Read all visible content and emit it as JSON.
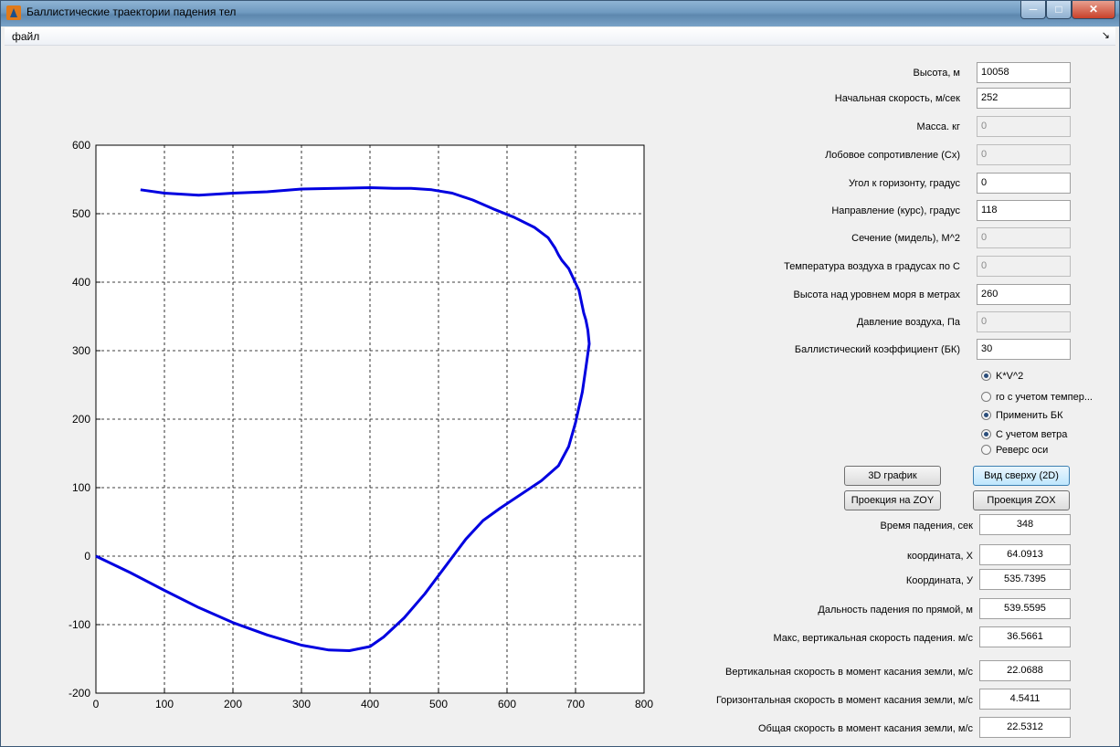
{
  "window": {
    "title": "Баллистические траектории падения тел",
    "icons": {
      "app": "matlab-icon",
      "min": "minimize-icon",
      "max": "maximize-icon",
      "close": "close-icon"
    }
  },
  "menu": {
    "file": "файл",
    "arrow": "↘"
  },
  "inputs": [
    {
      "label": "Высота, м",
      "value": "10058",
      "disabled": false
    },
    {
      "label": "Начальная скорость, м/сек",
      "value": "252",
      "disabled": false
    },
    {
      "label": "Масса. кг",
      "value": "0",
      "disabled": true
    },
    {
      "label": "Лобовое сопротивление (Cx)",
      "value": "0",
      "disabled": true
    },
    {
      "label": "Угол к горизонту, градус",
      "value": "0",
      "disabled": false
    },
    {
      "label": "Направление  (курс), градус",
      "value": "118",
      "disabled": false
    },
    {
      "label": "Сечение (мидель), M^2",
      "value": "0",
      "disabled": true
    },
    {
      "label": "Температура воздуха в градусах по С",
      "value": "0",
      "disabled": true
    },
    {
      "label": "Высота над уровнем моря в метрах",
      "value": "260",
      "disabled": false
    },
    {
      "label": "Давление воздуха, Па",
      "value": "0",
      "disabled": true
    },
    {
      "label": "Баллистический коэффициент (БК)",
      "value": "30",
      "disabled": false
    }
  ],
  "radios": [
    {
      "label": "K*V^2",
      "checked": true
    },
    {
      "label": "ro с учетом темпер...",
      "checked": false
    },
    {
      "label": "Применить БК",
      "checked": true
    },
    {
      "label": "С учетом ветра",
      "checked": true
    },
    {
      "label": "Реверс оси",
      "checked": false
    }
  ],
  "buttons": {
    "graph3d": "3D график",
    "topview": "Вид сверху (2D)",
    "zoy": "Проекция на ZOY",
    "zox": "Проекция ZOX"
  },
  "outputs": [
    {
      "label": "Время падения, сек",
      "value": "348"
    },
    {
      "label": "координата, X",
      "value": "64.0913"
    },
    {
      "label": "Координата, У",
      "value": "535.7395"
    },
    {
      "label": "Дальность падения по прямой, м",
      "value": "539.5595"
    },
    {
      "label": "Макс,  вертикальная скорость падения. м/с",
      "value": "36.5661"
    },
    {
      "label": "Вертикальная  скорость в момент касания земли, м/с",
      "value": "22.0688"
    },
    {
      "label": "Горизонтальная скорость в момент касания земли, м/с",
      "value": "4.5411"
    },
    {
      "label": "Общая скорость в момент касания земли, м/с",
      "value": "22.5312"
    }
  ],
  "chart_data": {
    "type": "line",
    "title": "",
    "xlabel": "",
    "ylabel": "",
    "xlim": [
      0,
      800
    ],
    "ylim": [
      -200,
      600
    ],
    "xticks": [
      "0",
      "100",
      "200",
      "300",
      "400",
      "500",
      "600",
      "700",
      "800"
    ],
    "yticks": [
      "600",
      "500",
      "400",
      "300",
      "200",
      "100",
      "0",
      "-100",
      "-200"
    ],
    "grid": true,
    "line_color": "#0000e0",
    "series": [
      {
        "x": [
          0,
          50,
          100,
          150,
          200,
          250,
          300,
          340,
          370,
          400,
          420,
          450,
          480,
          510,
          540,
          565,
          590,
          620,
          650,
          675,
          690,
          700,
          710,
          715,
          720,
          718,
          715,
          712,
          705,
          690,
          680,
          675,
          670,
          660,
          640,
          610,
          580,
          550,
          520,
          490,
          460,
          435,
          400,
          350,
          300,
          250,
          200,
          150,
          100,
          65
        ],
        "y": [
          0,
          -24,
          -50,
          -75,
          -97,
          -115,
          -130,
          -137,
          -138,
          -132,
          -118,
          -90,
          -55,
          -15,
          25,
          52,
          70,
          90,
          110,
          132,
          160,
          195,
          240,
          275,
          310,
          330,
          345,
          355,
          388,
          420,
          432,
          440,
          450,
          465,
          480,
          495,
          507,
          520,
          530,
          535,
          537,
          537,
          538,
          537,
          536,
          532,
          530,
          527,
          530,
          535
        ]
      }
    ]
  }
}
